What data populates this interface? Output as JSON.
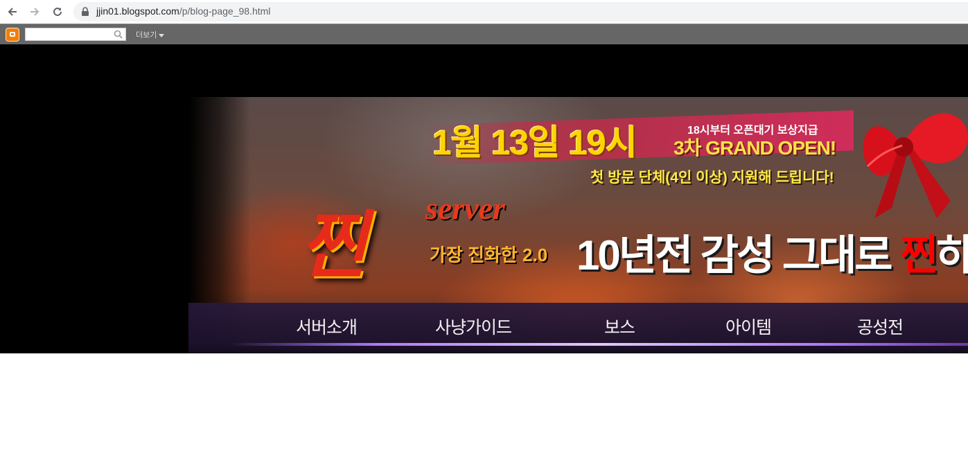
{
  "browser": {
    "url_host": "jjin01.blogspot.com",
    "url_path": "/p/blog-page_98.html"
  },
  "blogger_bar": {
    "search_value": "",
    "more_label": "더보기"
  },
  "banner": {
    "date": "1월 13일 19시",
    "open_note": "18시부터 오픈대기 보상지급",
    "grand_open": "3차 GRAND OPEN!",
    "visit_support": "첫 방문 단체(4인 이상) 지원해 드립니다!",
    "logo_main": "찐",
    "logo_server": "server",
    "logo_tagline": "가장 진화한 2.0",
    "slogan_white": "10년전 감성 그대로 ",
    "slogan_red": "찐",
    "slogan_tail": "하"
  },
  "menu": {
    "items": [
      {
        "label": "서버소개"
      },
      {
        "label": "사냥가이드"
      },
      {
        "label": "보스"
      },
      {
        "label": "아이템"
      },
      {
        "label": "공성전"
      }
    ]
  },
  "colors": {
    "blogger_bar_bg": "#666666",
    "blogger_orange": "#f57d00",
    "date_yellow": "#ffd400",
    "ribbon_red": "#cf2d5a",
    "menu_glow": "#b078ff"
  }
}
